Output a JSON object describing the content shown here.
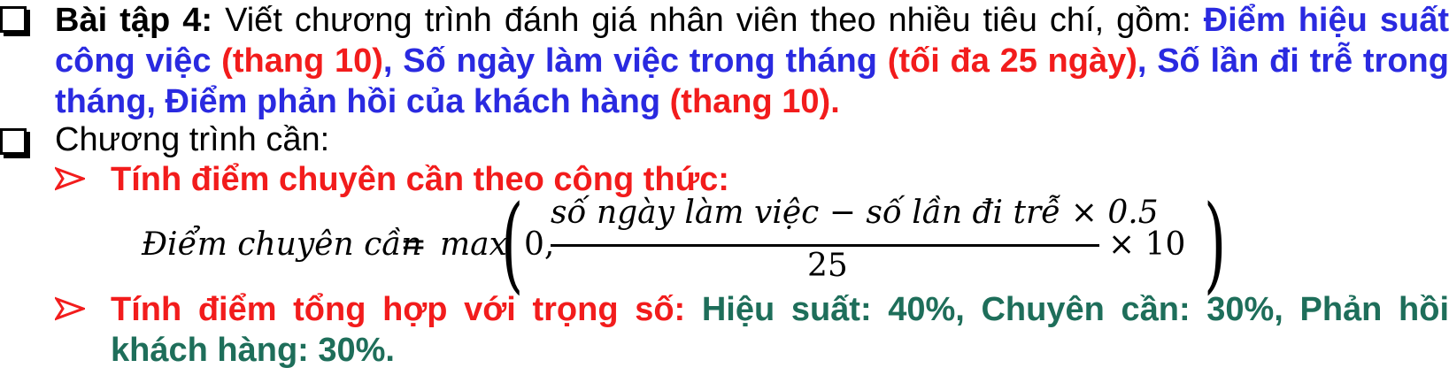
{
  "item1": {
    "label": "Bài tập 4:",
    "intro": " Viết chương trình đánh giá nhân viên theo nhiều tiêu chí, gồm: ",
    "crit1": "Điểm hiệu suất công việc",
    "crit1_note": " (thang 10)",
    "sep1": ", ",
    "crit2": "Số ngày làm việc trong tháng",
    "crit2_note": " (tối đa 25 ngày)",
    "sep2": ", ",
    "crit3": "Số lần đi trễ trong tháng, Điểm phản hồi của khách hàng",
    "crit3_note": " (thang 10)."
  },
  "item2": {
    "label": "Chương trình cần:"
  },
  "sub1": {
    "label": "Tính điểm chuyên cần theo công thức:"
  },
  "formula": {
    "lhs": "Điểm chuyên cần",
    "eq": "=",
    "func": "max",
    "zero": "0,",
    "numerator": "số ngày làm việc  − số lần đi trễ × 0.5",
    "denominator": "25",
    "times_ten": "× 10"
  },
  "sub2": {
    "label": "Tính điểm tổng hợp với trọng số:",
    "weights": " Hiệu suất: 40%, Chuyên cần: 30%, Phản hồi khách hàng: 30%."
  },
  "colors": {
    "blue": "#2a2ae0",
    "red": "#f21c1c",
    "green": "#1e6e5a"
  },
  "icons": {
    "bullet": "square-bullet-icon",
    "arrow": "arrow-bullet-icon"
  }
}
